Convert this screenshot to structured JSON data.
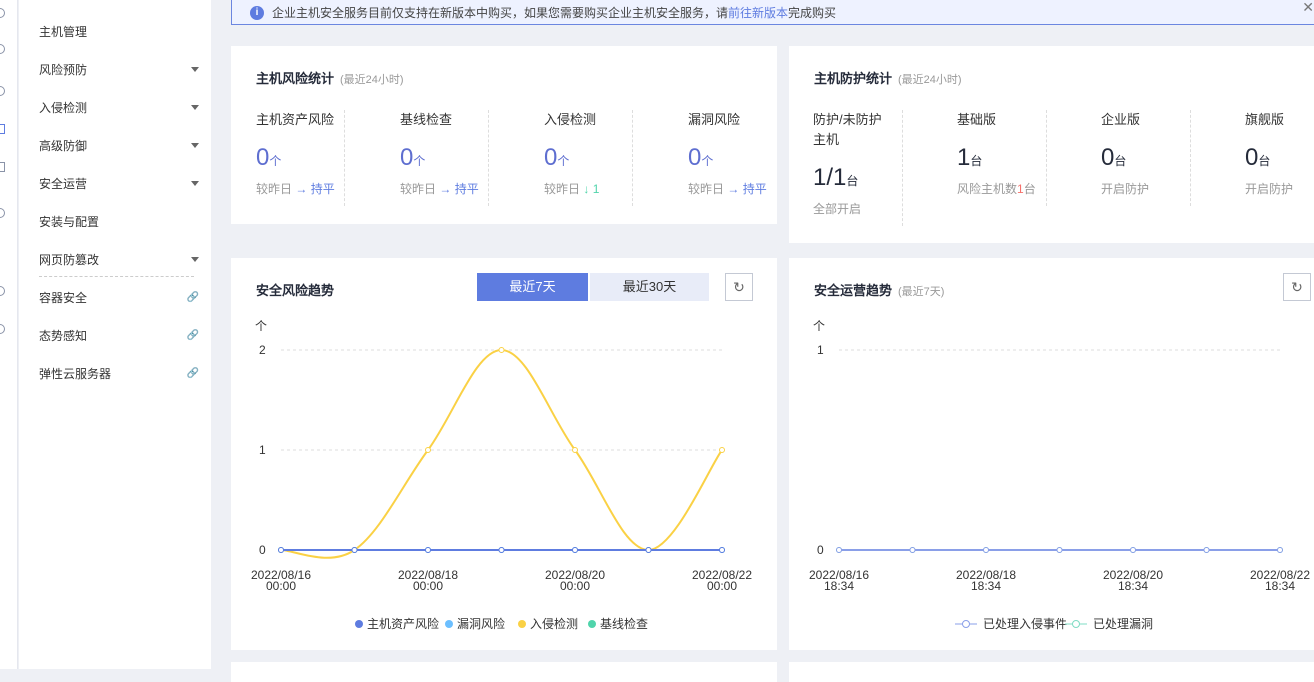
{
  "notice": {
    "text": "企业主机安全服务目前仅支持在新版本中购买，如果您需要购买企业主机安全服务，请",
    "link": "前往新版本",
    "suffix": "完成购买"
  },
  "sidebar": {
    "items": [
      {
        "label": "主机管理",
        "kind": "none"
      },
      {
        "label": "风险预防",
        "kind": "caret"
      },
      {
        "label": "入侵检测",
        "kind": "caret"
      },
      {
        "label": "高级防御",
        "kind": "caret"
      },
      {
        "label": "安全运营",
        "kind": "caret"
      },
      {
        "label": "安装与配置",
        "kind": "none"
      },
      {
        "label": "网页防篡改",
        "kind": "caret"
      },
      {
        "label": "容器安全",
        "kind": "link"
      },
      {
        "label": "态势感知",
        "kind": "link"
      },
      {
        "label": "弹性云服务器",
        "kind": "link"
      }
    ]
  },
  "risk_stats": {
    "title": "主机风险统计",
    "subtitle": "(最近24小时)",
    "items": [
      {
        "label": "主机资产风险",
        "value": "0",
        "unit": "个",
        "cmp": "较昨日",
        "arrow": "→",
        "delta": "持平"
      },
      {
        "label": "基线检查",
        "value": "0",
        "unit": "个",
        "cmp": "较昨日",
        "arrow": "→",
        "delta": "持平"
      },
      {
        "label": "入侵检测",
        "value": "0",
        "unit": "个",
        "cmp": "较昨日",
        "arrow": "↓",
        "delta": "1"
      },
      {
        "label": "漏洞风险",
        "value": "0",
        "unit": "个",
        "cmp": "较昨日",
        "arrow": "→",
        "delta": "持平"
      }
    ]
  },
  "protect_stats": {
    "title": "主机防护统计",
    "subtitle": "(最近24小时)",
    "items": [
      {
        "label": "防护/未防护主机",
        "value": "1/1",
        "unit": "台",
        "action": "全部开启"
      },
      {
        "label": "基础版",
        "value": "1",
        "unit": "台",
        "note_pre": "风险主机数",
        "note_num": "1",
        "note_suf": "台"
      },
      {
        "label": "企业版",
        "value": "0",
        "unit": "台",
        "action": "开启防护"
      },
      {
        "label": "旗舰版",
        "value": "0",
        "unit": "台",
        "action": "开启防护"
      }
    ]
  },
  "risk_trend": {
    "title": "安全风险趋势",
    "tab_7": "最近7天",
    "tab_30": "最近30天"
  },
  "ops_trend": {
    "title": "安全运营趋势",
    "subtitle": "(最近7天)"
  },
  "chart_data": [
    {
      "type": "line",
      "title": "安全风险趋势",
      "ylabel": "个",
      "ylim": [
        0,
        2
      ],
      "yticks": [
        "0",
        "1",
        "2"
      ],
      "x": [
        "2022/08/16 00:00",
        "2022/08/17 00:00",
        "2022/08/18 00:00",
        "2022/08/19 00:00",
        "2022/08/20 00:00",
        "2022/08/21 00:00",
        "2022/08/22 00:00"
      ],
      "xtick_labels": [
        [
          "2022/08/16",
          "00:00"
        ],
        [
          "2022/08/18",
          "00:00"
        ],
        [
          "2022/08/20",
          "00:00"
        ],
        [
          "2022/08/22",
          "00:00"
        ]
      ],
      "series": [
        {
          "name": "主机资产风险",
          "color": "#5e7ce0",
          "values": [
            0,
            0,
            0,
            0,
            0,
            0,
            0
          ]
        },
        {
          "name": "漏洞风险",
          "color": "#6cbfff",
          "values": [
            0,
            0,
            0,
            0,
            0,
            0,
            0
          ]
        },
        {
          "name": "入侵检测",
          "color": "#fad145",
          "values": [
            0,
            0,
            1,
            2,
            1,
            0,
            1
          ]
        },
        {
          "name": "基线检查",
          "color": "#50d4ab",
          "values": [
            0,
            0,
            0,
            0,
            0,
            0,
            0
          ]
        }
      ],
      "legend": "bottom"
    },
    {
      "type": "line",
      "title": "安全运营趋势",
      "ylabel": "个",
      "ylim": [
        0,
        1
      ],
      "yticks": [
        "0",
        "1"
      ],
      "x": [
        "2022/08/16 18:34",
        "2022/08/17 18:34",
        "2022/08/18 18:34",
        "2022/08/19 18:34",
        "2022/08/20 18:34",
        "2022/08/21 18:34",
        "2022/08/22 18:34"
      ],
      "xtick_labels": [
        [
          "2022/08/16",
          "18:34"
        ],
        [
          "2022/08/18",
          "18:34"
        ],
        [
          "2022/08/20",
          "18:34"
        ],
        [
          "2022/08/22",
          "18:34"
        ]
      ],
      "series": [
        {
          "name": "已处理入侵事件",
          "color": "#8a9fe8",
          "values": [
            0,
            0,
            0,
            0,
            0,
            0,
            0
          ]
        },
        {
          "name": "已处理漏洞",
          "color": "#7fdcc4",
          "values": [
            0,
            0,
            0,
            0,
            0,
            0,
            0
          ]
        }
      ],
      "legend": "bottom"
    }
  ]
}
